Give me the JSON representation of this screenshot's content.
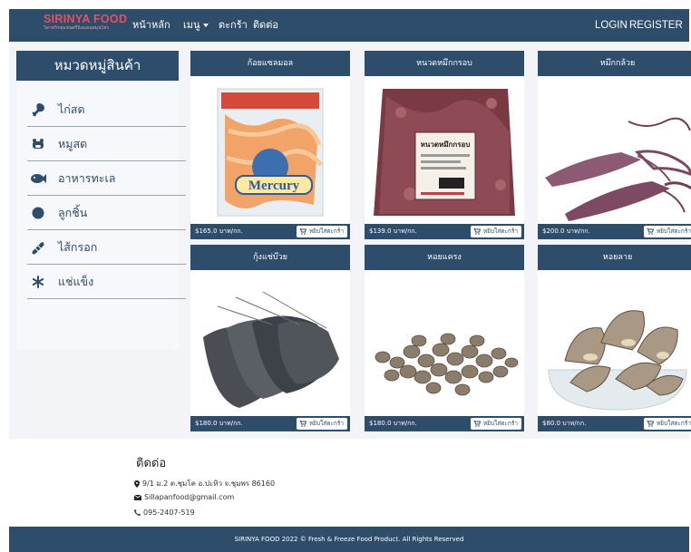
{
  "brand": {
    "name": "SIRINYA FOOD",
    "tagline": "วิสาหกิจชุมชนศรีนิลแคนสมุนไพร"
  },
  "nav": {
    "home": "หน้าหลัก",
    "menu": "เมนู",
    "cart": "ตะกร้า",
    "contact": "ติดต่อ",
    "login": "LOGIN",
    "register": "REGISTER"
  },
  "sidebar": {
    "title": "หมวดหมู่สินค้า",
    "items": [
      {
        "label": "ไก่สด",
        "icon": "drumstick-icon"
      },
      {
        "label": "หมูสด",
        "icon": "pig-icon"
      },
      {
        "label": "อาหารทะเล",
        "icon": "fish-icon"
      },
      {
        "label": "ลูกชิ้น",
        "icon": "ball-icon"
      },
      {
        "label": "ไส้กรอก",
        "icon": "sausage-icon"
      },
      {
        "label": "แช่แข็ง",
        "icon": "snowflake-icon"
      }
    ]
  },
  "products": [
    {
      "name": "ก้อยแซลมอล",
      "price": "$165.0 บาท/กก.",
      "button": "หยิบใส่ตะกร้า"
    },
    {
      "name": "หนวดหมึกกรอบ",
      "price": "$139.0 บาท/กก.",
      "button": "หยิบใส่ตะกร้า"
    },
    {
      "name": "หมึกกล้วย",
      "price": "$200.0 บาท/กก.",
      "button": "หยิบใส่ตะกร้า"
    },
    {
      "name": "กุ้งแช่บ๊วย",
      "price": "$180.0 บาท/กก.",
      "button": "หยิบใส่ตะกร้า"
    },
    {
      "name": "หอยแครง",
      "price": "$180.0 บาท/กก.",
      "button": "หยิบใส่ตะกร้า"
    },
    {
      "name": "หอยลาย",
      "price": "$80.0 บาท/กก.",
      "button": "หยิบใส่ตะกร้า"
    }
  ],
  "package_labels": {
    "mercury": "Mercury",
    "squid_pack": "หนวดหมึกกรอบ"
  },
  "contact": {
    "title": "ติดต่อ",
    "address": "9/1 ม.2 ต.ชุมโค อ.ปะทิว จ.ชุมพร 86160",
    "email": "Sillapanfood@gmail.com",
    "phone": "095-2407-519"
  },
  "footer": {
    "text": "SIRINYA FOOD 2022 © Fresh & Freeze Food Product. All Rights Reserved"
  },
  "colors": {
    "primary": "#2d4d6b",
    "brand": "#e8505b",
    "background": "#f2f4f8"
  }
}
